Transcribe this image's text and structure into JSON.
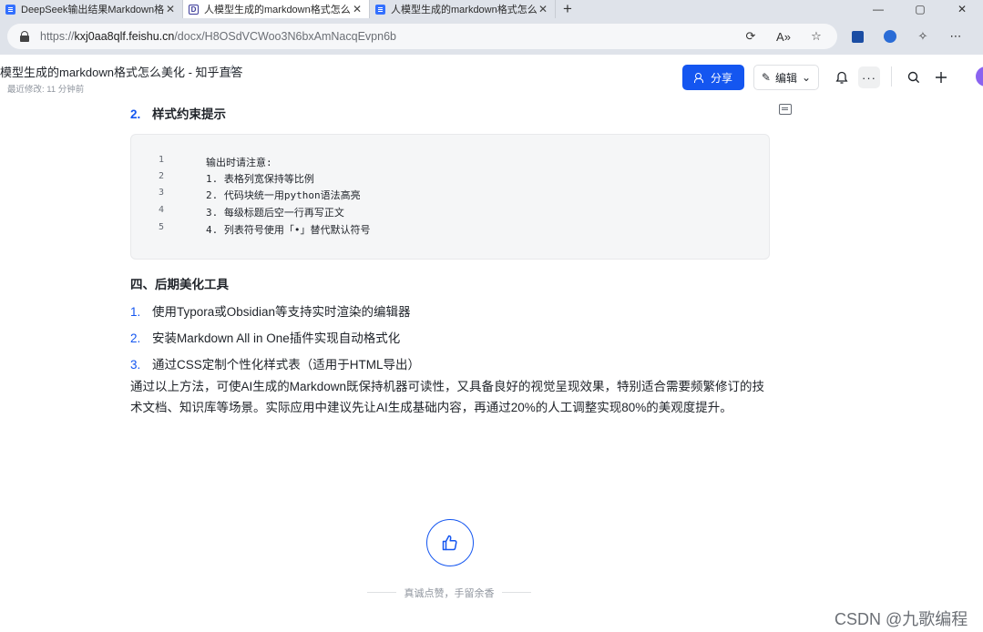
{
  "browser": {
    "tabs": [
      {
        "title": "DeepSeek输出结果Markdown格式",
        "favicon": "doc"
      },
      {
        "title": "人模型生成的markdown格式怎么",
        "favicon": "zh"
      },
      {
        "title": "人模型生成的markdown格式怎么",
        "favicon": "doc"
      }
    ],
    "new_tab": "+",
    "window_controls": [
      "—",
      "▢",
      "✕"
    ],
    "url": {
      "protocol": "https://",
      "host": "kxj0aa8qlf.feishu.cn",
      "path": "/docx/H8OSdVCWoo3N6bxAmNacqEvpn6b"
    }
  },
  "doc_header": {
    "title": "模型生成的markdown格式怎么美化 - 知乎直答",
    "meta": "最近修改: 11 分钟前",
    "share_label": "分享",
    "edit_label": "编辑"
  },
  "content": {
    "list1_item": {
      "num": "2.",
      "text": "样式约束提示"
    },
    "code_lines": [
      {
        "n": "1",
        "text": "输出时请注意:"
      },
      {
        "n": "2",
        "text": "1. 表格列宽保持等比例"
      },
      {
        "n": "3",
        "text": "2. 代码块统一用python语法高亮"
      },
      {
        "n": "4",
        "text": "3. 每级标题后空一行再写正文"
      },
      {
        "n": "5",
        "text": "4. 列表符号使用「•」替代默认符号"
      }
    ],
    "section_heading": "四、后期美化工具",
    "tools": [
      {
        "num": "1.",
        "text": "使用Typora或Obsidian等支持实时渲染的编辑器"
      },
      {
        "num": "2.",
        "text": "安装Markdown All in One插件实现自动格式化"
      },
      {
        "num": "3.",
        "text": "通过CSS定制个性化样式表（适用于HTML导出）"
      }
    ],
    "conclusion": "通过以上方法，可使AI生成的Markdown既保持机器可读性，又具备良好的视觉呈现效果，特别适合需要频繁修订的技术文档、知识库等场景。实际应用中建议先让AI生成基础内容，再通过20%的人工调整实现80%的美观度提升。"
  },
  "footer": {
    "like_caption": "真诚点赞，手留余香",
    "watermark": "CSDN @九歌编程"
  },
  "colors": {
    "accent": "#1456f0",
    "text": "#1f2329",
    "chrome": "#dfe3ea"
  }
}
